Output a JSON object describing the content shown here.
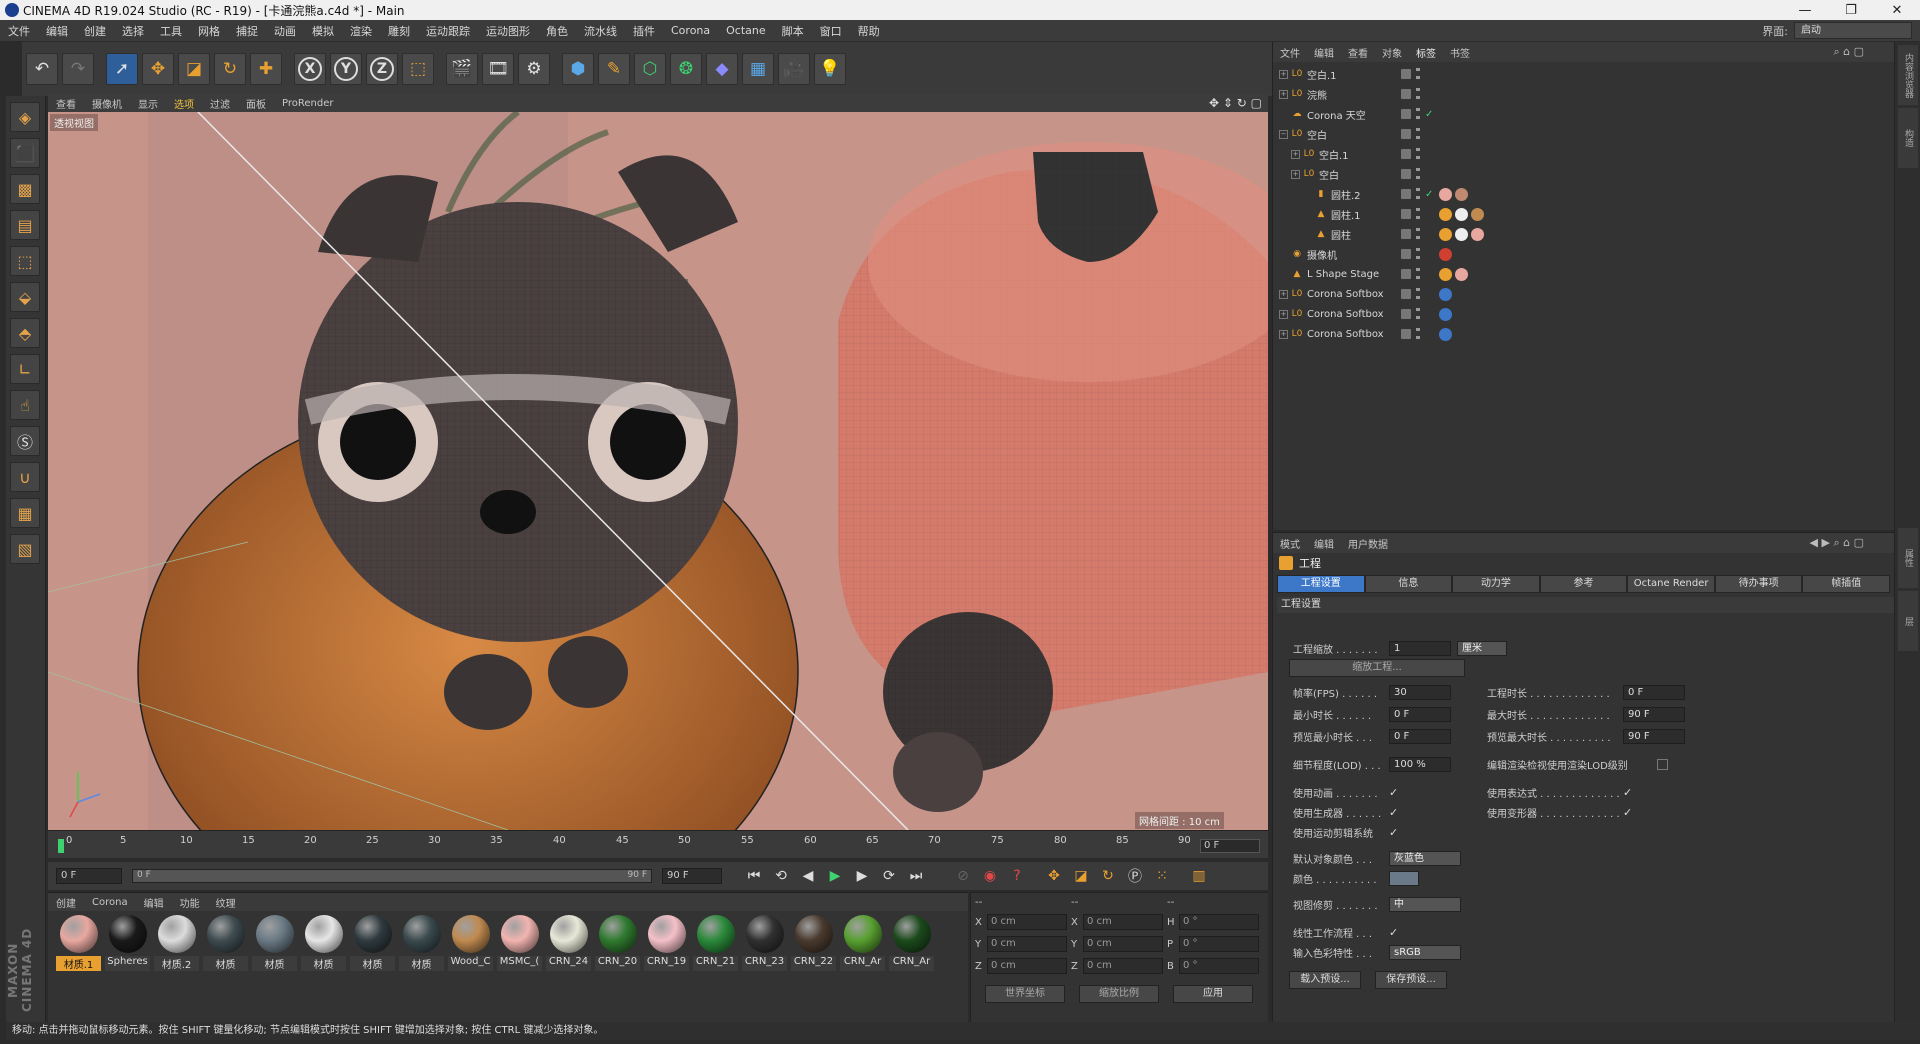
{
  "window": {
    "title": "CINEMA 4D R19.024 Studio (RC - R19) - [卡通浣熊a.c4d *] - Main",
    "min": "—",
    "max": "❐",
    "close": "✕"
  },
  "menu": [
    "文件",
    "编辑",
    "创建",
    "选择",
    "工具",
    "网格",
    "捕捉",
    "动画",
    "模拟",
    "渲染",
    "雕刻",
    "运动跟踪",
    "运动图形",
    "角色",
    "流水线",
    "插件",
    "Corona",
    "Octane",
    "脚本",
    "窗口",
    "帮助"
  ],
  "interface": {
    "label": "界面:",
    "value": "启动"
  },
  "viewport": {
    "menu": [
      "查看",
      "摄像机",
      "显示",
      "选项",
      "过滤",
      "面板"
    ],
    "prorender": "ProRender",
    "label": "透视视图",
    "grid_label": "网格间距 : 10 cm"
  },
  "timeline": {
    "ticks": [
      "0",
      "5",
      "10",
      "15",
      "20",
      "25",
      "30",
      "35",
      "40",
      "45",
      "50",
      "55",
      "60",
      "65",
      "70",
      "75",
      "80",
      "85",
      "90"
    ],
    "current_frame": "0 F"
  },
  "transport": {
    "start": "0 F",
    "range_start": "0 F",
    "range_end": "90 F",
    "end": "90 F"
  },
  "materials": {
    "menu": [
      "创建",
      "Corona",
      "编辑",
      "功能",
      "纹理"
    ],
    "items": [
      {
        "name": "材质.1",
        "color": "#e8a8a0",
        "selected": true
      },
      {
        "name": "Spheres",
        "color": "#1a1a1a"
      },
      {
        "name": "材质.2",
        "color": "#dcdcdc"
      },
      {
        "name": "材质",
        "color": "#3e4b50"
      },
      {
        "name": "材质",
        "color": "#6a7a85"
      },
      {
        "name": "材质",
        "color": "#e6e6e6"
      },
      {
        "name": "材质",
        "color": "#2f3a3f"
      },
      {
        "name": "材质",
        "color": "#3a4a4e"
      },
      {
        "name": "Wood_C",
        "color": "#c08a50"
      },
      {
        "name": "MSMC_(",
        "color": "#f2b4b0"
      },
      {
        "name": "CRN_24",
        "color": "#e8e8d8"
      },
      {
        "name": "CRN_20",
        "color": "#2f7a2f"
      },
      {
        "name": "CRN_19",
        "color": "#f5c0c8"
      },
      {
        "name": "CRN_21",
        "color": "#2a8a3a"
      },
      {
        "name": "CRN_23",
        "color": "#303030"
      },
      {
        "name": "CRN_22",
        "color": "#4a3a2e"
      },
      {
        "name": "CRN_Ar",
        "color": "#58a030"
      },
      {
        "name": "CRN_Ar",
        "color": "#1c4a1c"
      }
    ]
  },
  "coords": {
    "headers": [
      "--",
      "--",
      "--"
    ],
    "rows": [
      {
        "a": "X",
        "av": "0 cm",
        "b": "X",
        "bv": "0 cm",
        "c": "H",
        "cv": "0 °"
      },
      {
        "a": "Y",
        "av": "0 cm",
        "b": "Y",
        "bv": "0 cm",
        "c": "P",
        "cv": "0 °"
      },
      {
        "a": "Z",
        "av": "0 cm",
        "b": "Z",
        "bv": "0 cm",
        "c": "B",
        "cv": "0 °"
      }
    ],
    "world": "世界坐标",
    "scale": "缩放比例",
    "apply": "应用"
  },
  "status": "移动: 点击并拖动鼠标移动元素。按住 SHIFT 键量化移动; 节点编辑模式时按住 SHIFT 键增加选择对象; 按住 CTRL 键减少选择对象。",
  "objects": {
    "menu": [
      "文件",
      "编辑",
      "查看",
      "对象",
      "标签",
      "书签"
    ],
    "active_menu": "标签",
    "rows": [
      {
        "name": "空白.1",
        "indent": 0,
        "icon": "L0",
        "exp": "+"
      },
      {
        "name": "浣熊",
        "indent": 0,
        "icon": "L0",
        "exp": "+"
      },
      {
        "name": "Corona 天空",
        "indent": 0,
        "icon": "☁",
        "exp": "",
        "check": "✓"
      },
      {
        "name": "空白",
        "indent": 0,
        "icon": "L0",
        "exp": "−"
      },
      {
        "name": "空白.1",
        "indent": 1,
        "icon": "L0",
        "exp": "+"
      },
      {
        "name": "空白",
        "indent": 1,
        "icon": "L0",
        "exp": "+"
      },
      {
        "name": "圆柱.2",
        "indent": 2,
        "icon": "▮",
        "exp": "",
        "check": "✓",
        "tags": [
          "#e8a8a0",
          "#c08a70"
        ]
      },
      {
        "name": "圆柱.1",
        "indent": 2,
        "icon": "▲",
        "exp": "",
        "tags": [
          "#e8a030",
          "#eee",
          "#c08a50"
        ]
      },
      {
        "name": "圆柱",
        "indent": 2,
        "icon": "▲",
        "exp": "",
        "tags": [
          "#e8a030",
          "#eee",
          "#e8a8a0"
        ]
      },
      {
        "name": "摄像机",
        "indent": 0,
        "icon": "◉",
        "exp": "",
        "tags": [
          "#d04030"
        ]
      },
      {
        "name": "L Shape Stage",
        "indent": 0,
        "icon": "▲",
        "exp": "",
        "tags": [
          "#e8a030",
          "#e8a8a0"
        ]
      },
      {
        "name": "Corona Softbox",
        "indent": 0,
        "icon": "L0",
        "exp": "+",
        "tags": [
          "#3d78c8"
        ]
      },
      {
        "name": "Corona Softbox",
        "indent": 0,
        "icon": "L0",
        "exp": "+",
        "tags": [
          "#3d78c8"
        ]
      },
      {
        "name": "Corona Softbox",
        "indent": 0,
        "icon": "L0",
        "exp": "+",
        "tags": [
          "#3d78c8"
        ]
      }
    ]
  },
  "attributes": {
    "menu": [
      "模式",
      "编辑",
      "用户数据"
    ],
    "title": "工程",
    "tabs": [
      "工程设置",
      "信息",
      "动力学",
      "参考",
      "Octane Render",
      "待办事项",
      "帧插值"
    ],
    "active_tab": "工程设置",
    "section": "工程设置",
    "scale_label": "工程缩放 . . . . . . .",
    "scale_value": "1",
    "scale_unit": "厘米",
    "scale_button": "缩放工程...",
    "fps_label": "帧率(FPS) . . . . . .",
    "fps": "30",
    "dur_label": "工程时长 . . . . . . . . . . . . .",
    "dur": "0 F",
    "min_label": "最小时长 . . . . . .",
    "min": "0 F",
    "max_label": "最大时长 . . . . . . . . . . . . .",
    "max": "90 F",
    "pmin_label": "预览最小时长 . . .",
    "pmin": "0 F",
    "pmax_label": "预览最大时长 . . . . . . . . . .",
    "pmax": "90 F",
    "lod_label": "细节程度(LOD) . . .",
    "lod": "100 %",
    "lod_render_label": "编辑渲染检视使用渲染LOD级别",
    "anim_label": "使用动画 . . . . . . .",
    "expr_label": "使用表达式 . . . . . . . . . . . . .",
    "gen_label": "使用生成器 . . . . . .",
    "deform_label": "使用变形器 . . . . . . . . . . . . .",
    "motion_label": "使用运动剪辑系统",
    "objcolor_label": "默认对象颜色 . . .",
    "objcolor": "灰蓝色",
    "color_label": "颜色 . . . . . . . . . .",
    "clip_label": "视图修剪 . . . . . . .",
    "clip": "中",
    "linear_label": "线性工作流程 . . .",
    "input_label": "输入色彩特性 . . .",
    "input": "sRGB",
    "load": "载入预设...",
    "save": "保存预设..."
  },
  "right_strip": [
    "内容浏览器",
    "构造",
    "属性",
    "层"
  ],
  "colors": {
    "accent": "#3d78c8",
    "selected_mat": "#e8a030",
    "viewport_bg": "#c7948a"
  }
}
